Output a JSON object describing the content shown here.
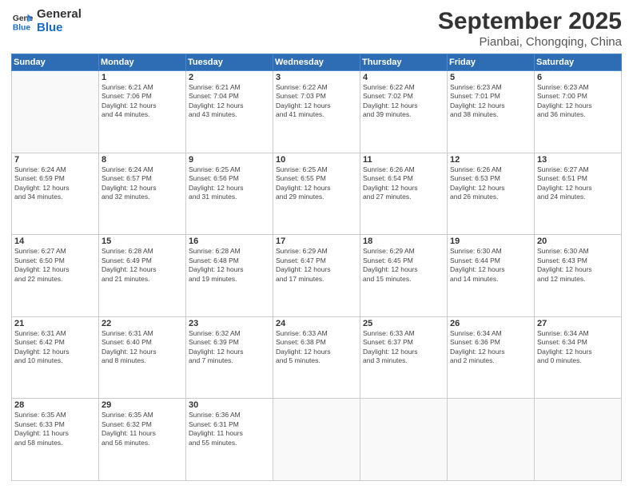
{
  "header": {
    "logo_line1": "General",
    "logo_line2": "Blue",
    "month": "September 2025",
    "location": "Pianbai, Chongqing, China"
  },
  "weekdays": [
    "Sunday",
    "Monday",
    "Tuesday",
    "Wednesday",
    "Thursday",
    "Friday",
    "Saturday"
  ],
  "weeks": [
    [
      {
        "day": "",
        "info": ""
      },
      {
        "day": "1",
        "info": "Sunrise: 6:21 AM\nSunset: 7:06 PM\nDaylight: 12 hours\nand 44 minutes."
      },
      {
        "day": "2",
        "info": "Sunrise: 6:21 AM\nSunset: 7:04 PM\nDaylight: 12 hours\nand 43 minutes."
      },
      {
        "day": "3",
        "info": "Sunrise: 6:22 AM\nSunset: 7:03 PM\nDaylight: 12 hours\nand 41 minutes."
      },
      {
        "day": "4",
        "info": "Sunrise: 6:22 AM\nSunset: 7:02 PM\nDaylight: 12 hours\nand 39 minutes."
      },
      {
        "day": "5",
        "info": "Sunrise: 6:23 AM\nSunset: 7:01 PM\nDaylight: 12 hours\nand 38 minutes."
      },
      {
        "day": "6",
        "info": "Sunrise: 6:23 AM\nSunset: 7:00 PM\nDaylight: 12 hours\nand 36 minutes."
      }
    ],
    [
      {
        "day": "7",
        "info": "Sunrise: 6:24 AM\nSunset: 6:59 PM\nDaylight: 12 hours\nand 34 minutes."
      },
      {
        "day": "8",
        "info": "Sunrise: 6:24 AM\nSunset: 6:57 PM\nDaylight: 12 hours\nand 32 minutes."
      },
      {
        "day": "9",
        "info": "Sunrise: 6:25 AM\nSunset: 6:56 PM\nDaylight: 12 hours\nand 31 minutes."
      },
      {
        "day": "10",
        "info": "Sunrise: 6:25 AM\nSunset: 6:55 PM\nDaylight: 12 hours\nand 29 minutes."
      },
      {
        "day": "11",
        "info": "Sunrise: 6:26 AM\nSunset: 6:54 PM\nDaylight: 12 hours\nand 27 minutes."
      },
      {
        "day": "12",
        "info": "Sunrise: 6:26 AM\nSunset: 6:53 PM\nDaylight: 12 hours\nand 26 minutes."
      },
      {
        "day": "13",
        "info": "Sunrise: 6:27 AM\nSunset: 6:51 PM\nDaylight: 12 hours\nand 24 minutes."
      }
    ],
    [
      {
        "day": "14",
        "info": "Sunrise: 6:27 AM\nSunset: 6:50 PM\nDaylight: 12 hours\nand 22 minutes."
      },
      {
        "day": "15",
        "info": "Sunrise: 6:28 AM\nSunset: 6:49 PM\nDaylight: 12 hours\nand 21 minutes."
      },
      {
        "day": "16",
        "info": "Sunrise: 6:28 AM\nSunset: 6:48 PM\nDaylight: 12 hours\nand 19 minutes."
      },
      {
        "day": "17",
        "info": "Sunrise: 6:29 AM\nSunset: 6:47 PM\nDaylight: 12 hours\nand 17 minutes."
      },
      {
        "day": "18",
        "info": "Sunrise: 6:29 AM\nSunset: 6:45 PM\nDaylight: 12 hours\nand 15 minutes."
      },
      {
        "day": "19",
        "info": "Sunrise: 6:30 AM\nSunset: 6:44 PM\nDaylight: 12 hours\nand 14 minutes."
      },
      {
        "day": "20",
        "info": "Sunrise: 6:30 AM\nSunset: 6:43 PM\nDaylight: 12 hours\nand 12 minutes."
      }
    ],
    [
      {
        "day": "21",
        "info": "Sunrise: 6:31 AM\nSunset: 6:42 PM\nDaylight: 12 hours\nand 10 minutes."
      },
      {
        "day": "22",
        "info": "Sunrise: 6:31 AM\nSunset: 6:40 PM\nDaylight: 12 hours\nand 8 minutes."
      },
      {
        "day": "23",
        "info": "Sunrise: 6:32 AM\nSunset: 6:39 PM\nDaylight: 12 hours\nand 7 minutes."
      },
      {
        "day": "24",
        "info": "Sunrise: 6:33 AM\nSunset: 6:38 PM\nDaylight: 12 hours\nand 5 minutes."
      },
      {
        "day": "25",
        "info": "Sunrise: 6:33 AM\nSunset: 6:37 PM\nDaylight: 12 hours\nand 3 minutes."
      },
      {
        "day": "26",
        "info": "Sunrise: 6:34 AM\nSunset: 6:36 PM\nDaylight: 12 hours\nand 2 minutes."
      },
      {
        "day": "27",
        "info": "Sunrise: 6:34 AM\nSunset: 6:34 PM\nDaylight: 12 hours\nand 0 minutes."
      }
    ],
    [
      {
        "day": "28",
        "info": "Sunrise: 6:35 AM\nSunset: 6:33 PM\nDaylight: 11 hours\nand 58 minutes."
      },
      {
        "day": "29",
        "info": "Sunrise: 6:35 AM\nSunset: 6:32 PM\nDaylight: 11 hours\nand 56 minutes."
      },
      {
        "day": "30",
        "info": "Sunrise: 6:36 AM\nSunset: 6:31 PM\nDaylight: 11 hours\nand 55 minutes."
      },
      {
        "day": "",
        "info": ""
      },
      {
        "day": "",
        "info": ""
      },
      {
        "day": "",
        "info": ""
      },
      {
        "day": "",
        "info": ""
      }
    ]
  ]
}
